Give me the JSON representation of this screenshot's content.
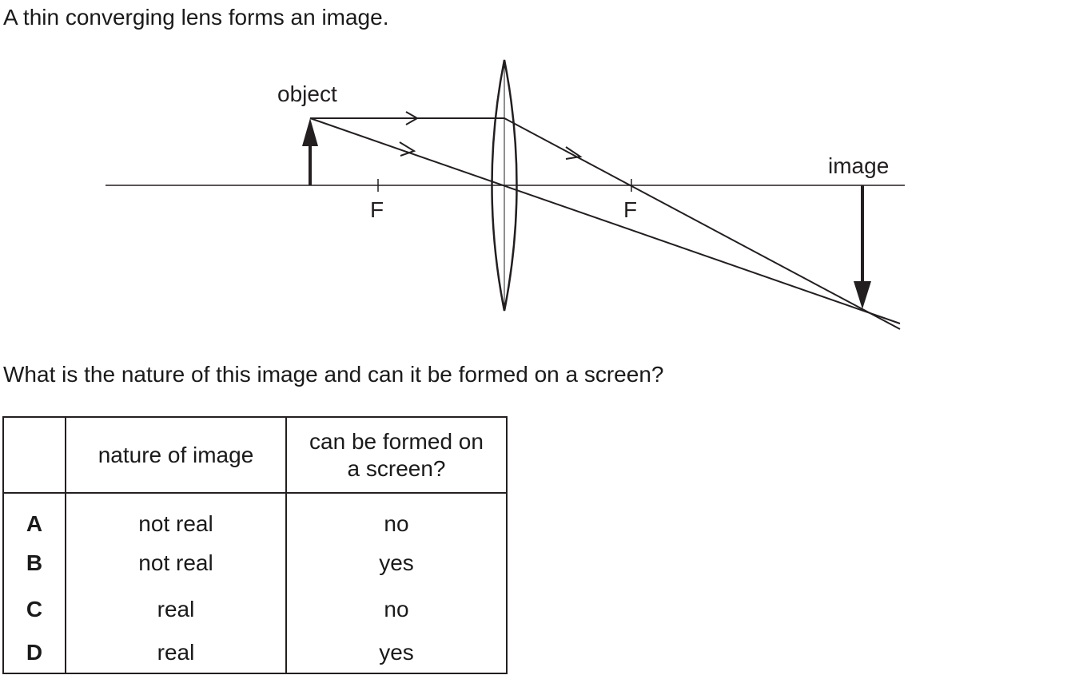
{
  "intro_text": "A thin converging lens forms an image.",
  "diagram": {
    "object_label": "object",
    "image_label": "image",
    "focal_label_left": "F",
    "focal_label_right": "F"
  },
  "question_text": "What is the nature of this image and can it be formed on a screen?",
  "table": {
    "headers": [
      "",
      "nature of image",
      "can be formed on a screen?"
    ],
    "rows": [
      {
        "option": "A",
        "nature": "not real",
        "screen": "no"
      },
      {
        "option": "B",
        "nature": "not real",
        "screen": "yes"
      },
      {
        "option": "C",
        "nature": "real",
        "screen": "no"
      },
      {
        "option": "D",
        "nature": "real",
        "screen": "yes"
      }
    ]
  }
}
